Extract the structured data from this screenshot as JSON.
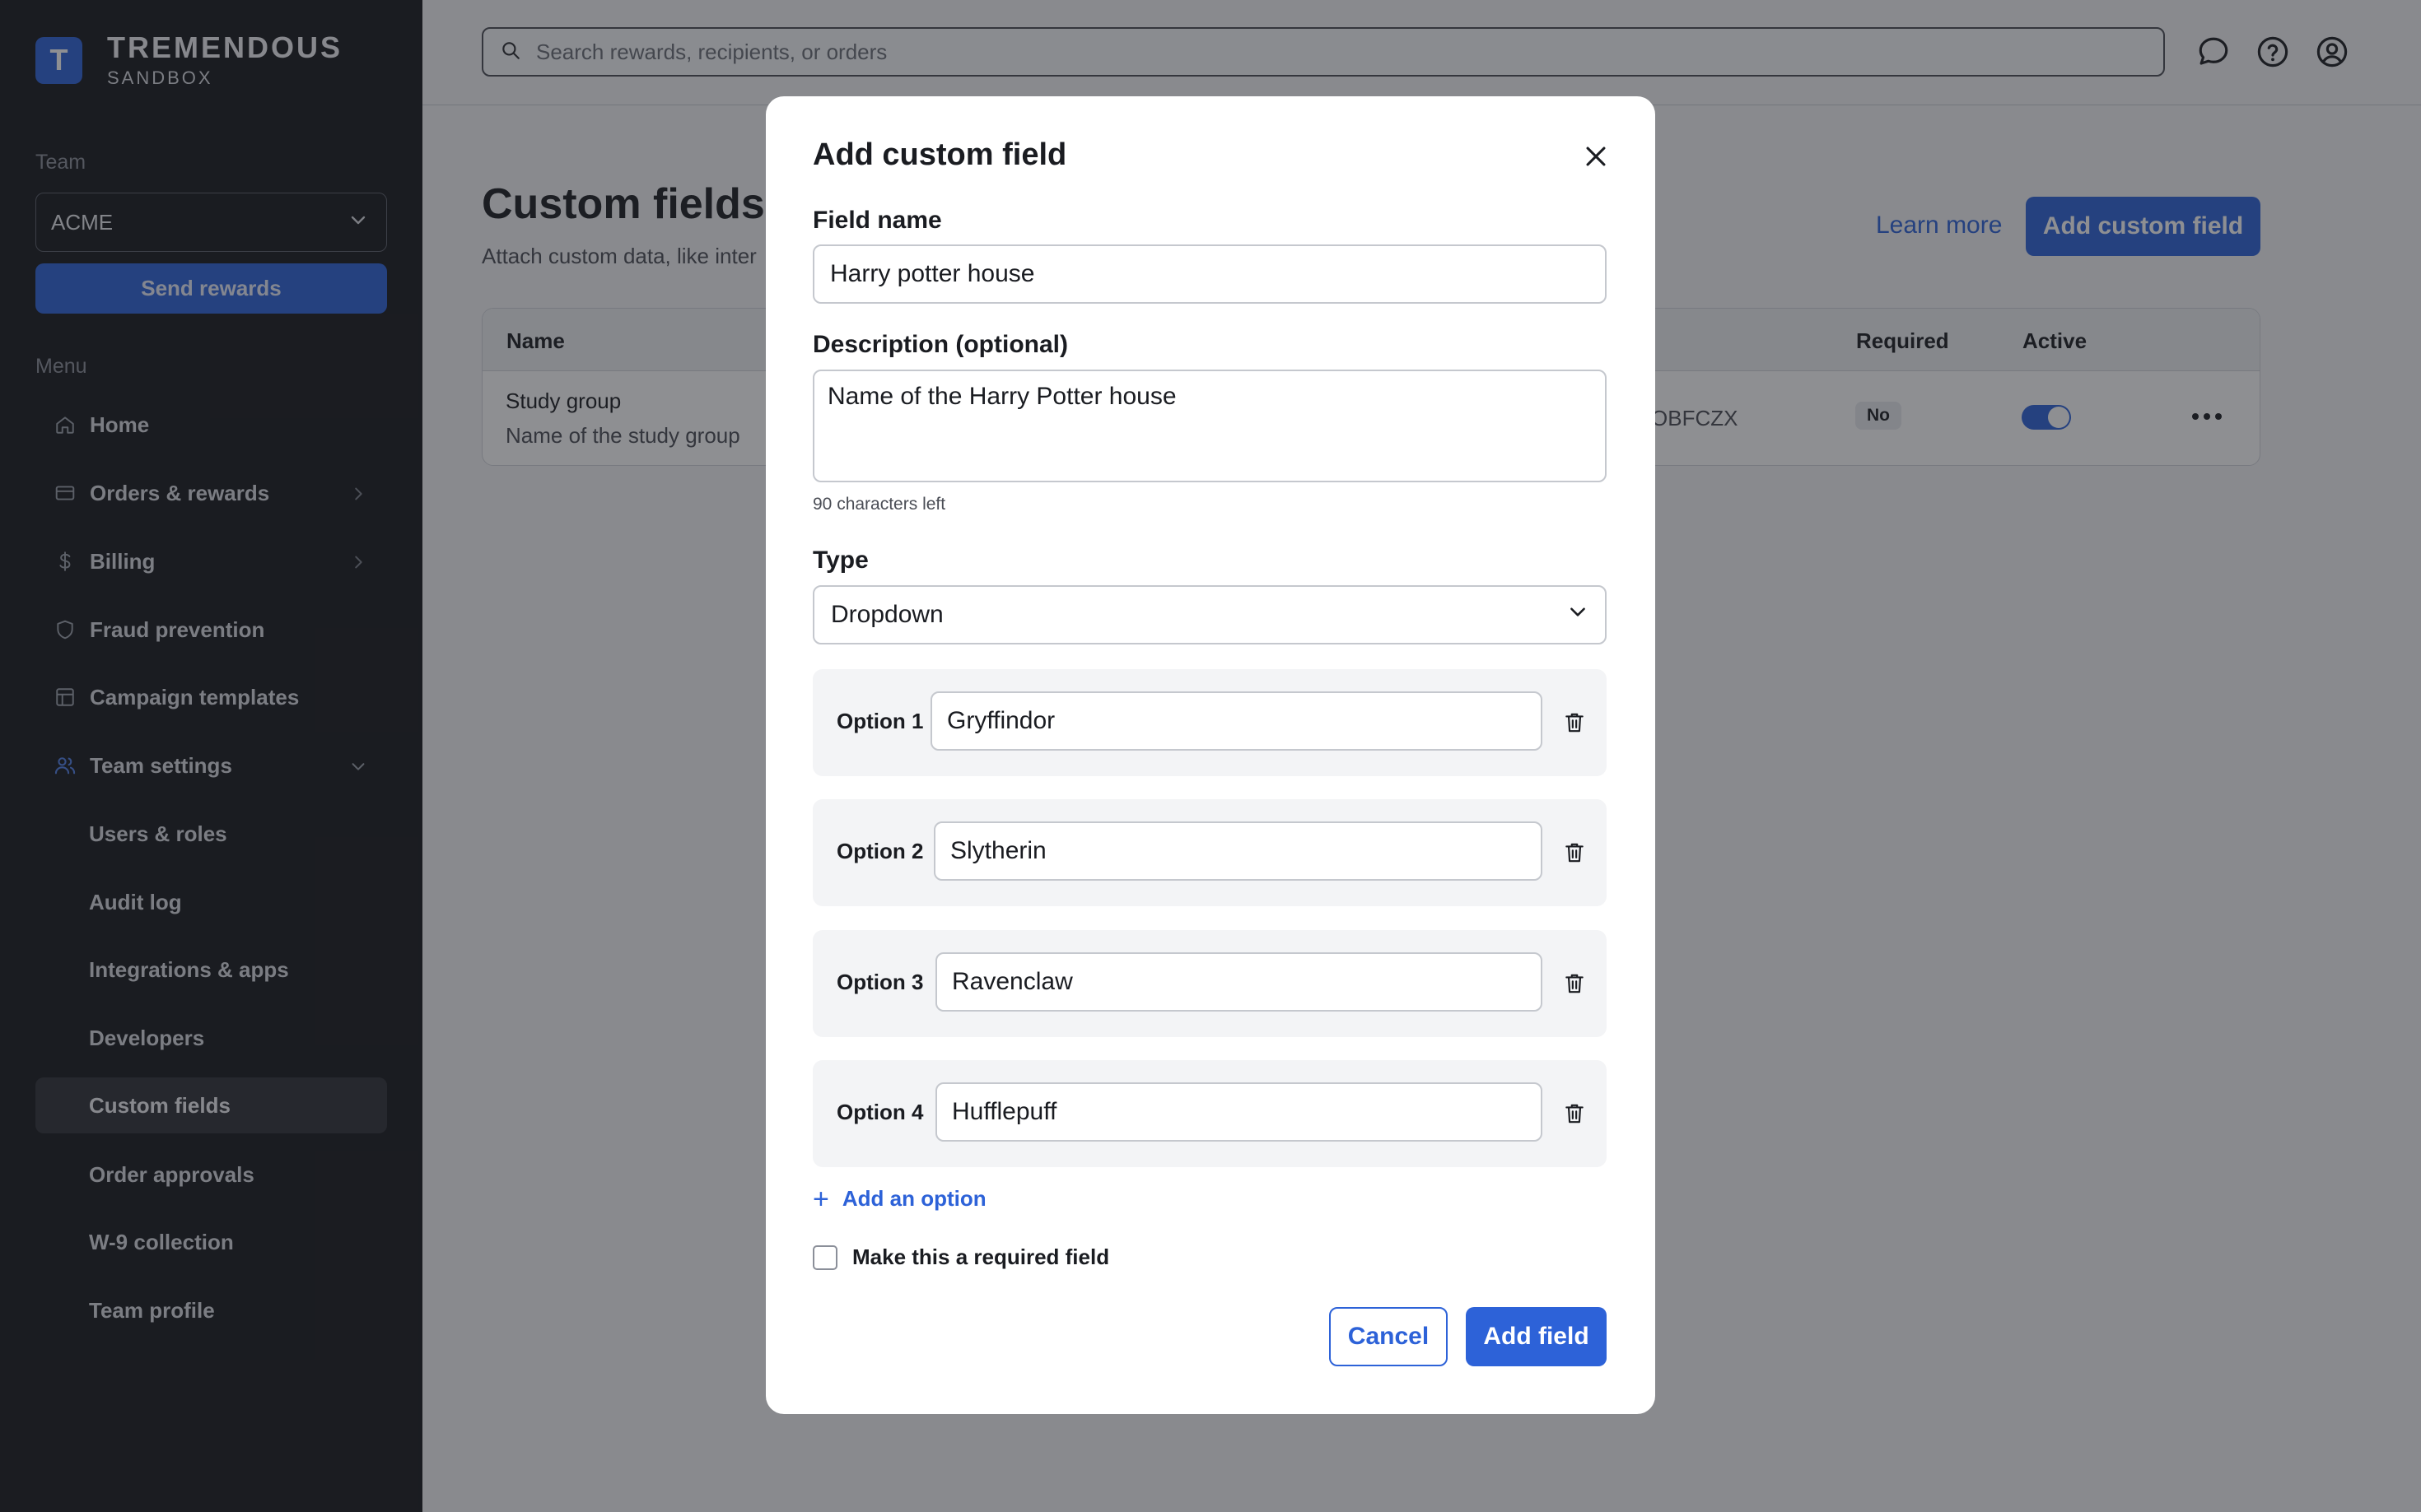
{
  "brand": {
    "logo_letter": "T",
    "name": "TREMENDOUS",
    "sub": "SANDBOX"
  },
  "sidebar": {
    "team_label": "Team",
    "team_value": "ACME",
    "send_rewards": "Send rewards",
    "menu_label": "Menu",
    "items": [
      {
        "label": "Home",
        "icon": "home-icon"
      },
      {
        "label": "Orders & rewards",
        "icon": "card-icon"
      },
      {
        "label": "Billing",
        "icon": "dollar-icon"
      },
      {
        "label": "Fraud prevention",
        "icon": "shield-icon"
      },
      {
        "label": "Campaign templates",
        "icon": "template-icon"
      },
      {
        "label": "Team settings",
        "icon": "users-icon"
      }
    ],
    "sub_items": [
      {
        "label": "Users & roles"
      },
      {
        "label": "Audit log"
      },
      {
        "label": "Integrations & apps"
      },
      {
        "label": "Developers"
      },
      {
        "label": "Custom fields"
      },
      {
        "label": "Order approvals"
      },
      {
        "label": "W-9 collection"
      },
      {
        "label": "Team profile"
      }
    ]
  },
  "topbar": {
    "search_placeholder": "Search rewards, recipients, or orders"
  },
  "page": {
    "title": "Custom fields",
    "subtitle": "Attach custom data, like inter",
    "learn_more": "Learn more",
    "add_button": "Add custom field",
    "table": {
      "headers": {
        "name": "Name",
        "required": "Required",
        "active": "Active"
      },
      "rows": [
        {
          "name": "Study group",
          "description": "Name of the study group",
          "id": "OBFCZX",
          "required": "No",
          "active": true
        }
      ]
    }
  },
  "modal": {
    "title": "Add custom field",
    "field_name_label": "Field name",
    "field_name_value": "Harry potter house",
    "description_label": "Description (optional)",
    "description_value": "Name of the Harry Potter house",
    "chars_left": "90 characters left",
    "type_label": "Type",
    "type_value": "Dropdown",
    "options": [
      {
        "label": "Option 1",
        "value": "Gryffindor"
      },
      {
        "label": "Option 2",
        "value": "Slytherin"
      },
      {
        "label": "Option 3",
        "value": "Ravenclaw"
      },
      {
        "label": "Option 4",
        "value": "Hufflepuff"
      }
    ],
    "add_option": "Add an option",
    "required_label": "Make this a required field",
    "cancel": "Cancel",
    "submit": "Add field"
  },
  "colors": {
    "accent": "#2d62d8",
    "sidebar_bg": "#17181c"
  }
}
